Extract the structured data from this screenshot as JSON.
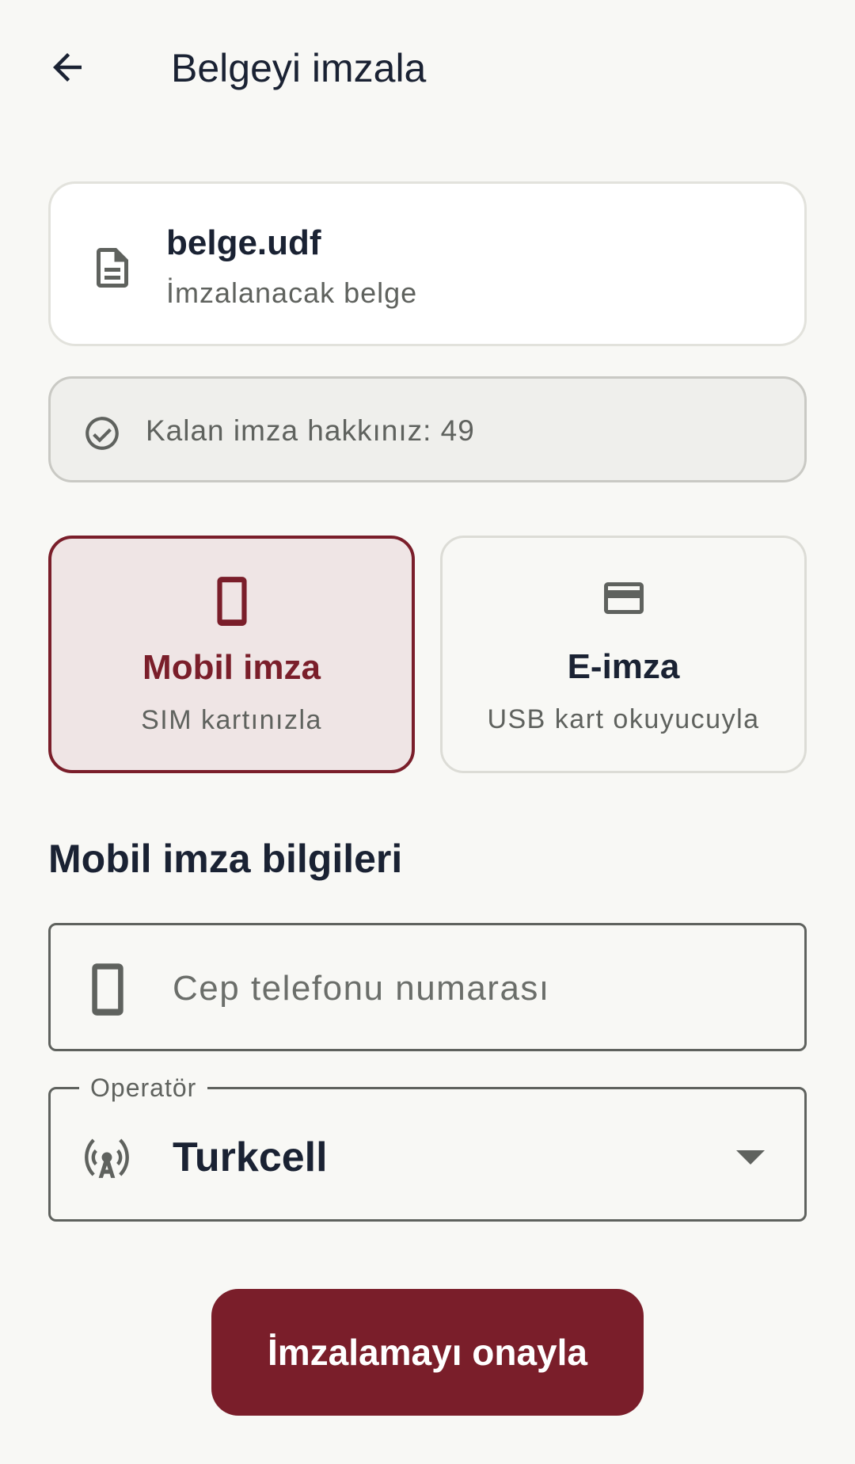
{
  "header": {
    "title": "Belgeyi imzala",
    "back_icon": "arrow-left-icon"
  },
  "document": {
    "name": "belge.udf",
    "subtitle": "İmzalanacak belge",
    "icon": "document-icon"
  },
  "remaining": {
    "text": "Kalan imza hakkınız: 49",
    "icon": "check-circle-icon"
  },
  "methods": [
    {
      "title": "Mobil imza",
      "subtitle": "SIM kartınızla",
      "icon": "smartphone-icon",
      "selected": true
    },
    {
      "title": "E-imza",
      "subtitle": "USB kart okuyucuyla",
      "icon": "credit-card-icon",
      "selected": false
    }
  ],
  "section": {
    "title": "Mobil imza bilgileri"
  },
  "phone": {
    "placeholder": "Cep telefonu numarası",
    "value": "",
    "icon": "smartphone-icon"
  },
  "operator": {
    "label": "Operatör",
    "value": "Turkcell",
    "icon": "antenna-icon"
  },
  "confirm": {
    "label": "İmzalamayı onayla"
  },
  "colors": {
    "accent": "#7a1e2a",
    "background": "#f8f8f5",
    "selected_bg": "#efe5e5",
    "text": "#1a2233",
    "muted": "#5f625e"
  }
}
